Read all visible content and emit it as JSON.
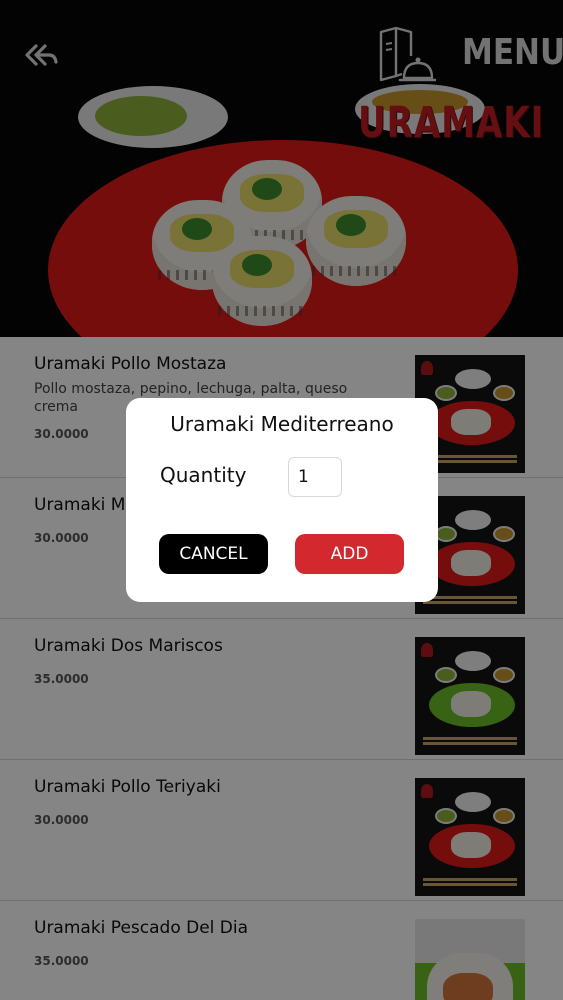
{
  "header": {
    "menu_label": "MENU",
    "category_title": "URAMAKI"
  },
  "items": [
    {
      "name": "Uramaki Pollo Mostaza",
      "description": "Pollo mostaza, pepino, lechuga, palta, queso crema",
      "price": "30.0000",
      "plate_color": "#e0191a"
    },
    {
      "name": "Uramaki M",
      "description": "",
      "price": "30.0000",
      "plate_color": "#e0191a"
    },
    {
      "name": "Uramaki Dos Mariscos",
      "description": "",
      "price": "35.0000",
      "plate_color": "#6bbf2a"
    },
    {
      "name": "Uramaki Pollo Teriyaki",
      "description": "",
      "price": "30.0000",
      "plate_color": "#e0191a"
    },
    {
      "name": "Uramaki Pescado Del Dia",
      "description": "",
      "price": "35.0000",
      "plate_color": "#6bbf2a"
    }
  ],
  "dialog": {
    "title": "Uramaki Mediterreano",
    "quantity_label": "Quantity",
    "quantity_value": "1",
    "cancel_label": "CANCEL",
    "add_label": "ADD",
    "cancel_color": "#000000",
    "add_color": "#d3282e"
  },
  "icons": {
    "back": "double-back-arrow-icon",
    "menu": "menu-card-cloche-icon"
  }
}
